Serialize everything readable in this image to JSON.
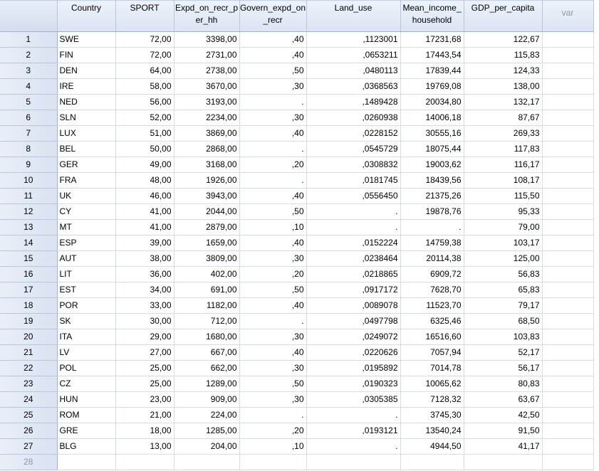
{
  "columns": [
    {
      "key": "Country",
      "label": "Country"
    },
    {
      "key": "SPORT",
      "label": "SPORT"
    },
    {
      "key": "Expd",
      "label": "Expd_on_recr_per_hh"
    },
    {
      "key": "Govern",
      "label": "Govern_expd_on_recr"
    },
    {
      "key": "Land",
      "label": "Land_use"
    },
    {
      "key": "Mean",
      "label": "Mean_income_household"
    },
    {
      "key": "GDP",
      "label": "GDP_per_capita"
    },
    {
      "key": "var",
      "label": "var"
    }
  ],
  "rows": [
    {
      "n": "1",
      "cells": [
        "SWE",
        "72,00",
        "3398,00",
        ",40",
        ",1123001",
        "17231,68",
        "122,67"
      ]
    },
    {
      "n": "2",
      "cells": [
        "FIN",
        "72,00",
        "2731,00",
        ",40",
        ",0653211",
        "17443,54",
        "115,83"
      ]
    },
    {
      "n": "3",
      "cells": [
        "DEN",
        "64,00",
        "2738,00",
        ",50",
        ",0480113",
        "17839,44",
        "124,33"
      ]
    },
    {
      "n": "4",
      "cells": [
        "IRE",
        "58,00",
        "3670,00",
        ",30",
        ",0368563",
        "19769,08",
        "138,00"
      ]
    },
    {
      "n": "5",
      "cells": [
        "NED",
        "56,00",
        "3193,00",
        ".",
        ",1489428",
        "20034,80",
        "132,17"
      ]
    },
    {
      "n": "6",
      "cells": [
        "SLN",
        "52,00",
        "2234,00",
        ",30",
        ",0260938",
        "14006,18",
        "87,67"
      ]
    },
    {
      "n": "7",
      "cells": [
        "LUX",
        "51,00",
        "3869,00",
        ",40",
        ",0228152",
        "30555,16",
        "269,33"
      ]
    },
    {
      "n": "8",
      "cells": [
        "BEL",
        "50,00",
        "2868,00",
        ".",
        ",0545729",
        "18075,44",
        "117,83"
      ]
    },
    {
      "n": "9",
      "cells": [
        "GER",
        "49,00",
        "3168,00",
        ",20",
        ",0308832",
        "19003,62",
        "116,17"
      ]
    },
    {
      "n": "10",
      "cells": [
        "FRA",
        "48,00",
        "1926,00",
        ".",
        ",0181745",
        "18439,56",
        "108,17"
      ]
    },
    {
      "n": "11",
      "cells": [
        "UK",
        "46,00",
        "3943,00",
        ",40",
        ",0556450",
        "21375,26",
        "115,50"
      ]
    },
    {
      "n": "12",
      "cells": [
        "CY",
        "41,00",
        "2044,00",
        ",50",
        ".",
        "19878,76",
        "95,33"
      ]
    },
    {
      "n": "13",
      "cells": [
        "MT",
        "41,00",
        "2879,00",
        ",10",
        ".",
        ".",
        "79,00"
      ]
    },
    {
      "n": "14",
      "cells": [
        "ESP",
        "39,00",
        "1659,00",
        ",40",
        ",0152224",
        "14759,38",
        "103,17"
      ]
    },
    {
      "n": "15",
      "cells": [
        "AUT",
        "38,00",
        "3809,00",
        ",30",
        ",0238464",
        "20114,38",
        "125,00"
      ]
    },
    {
      "n": "16",
      "cells": [
        "LIT",
        "36,00",
        "402,00",
        ",20",
        ",0218865",
        "6909,72",
        "56,83"
      ]
    },
    {
      "n": "17",
      "cells": [
        "EST",
        "34,00",
        "691,00",
        ",50",
        ",0917172",
        "7628,70",
        "65,83"
      ]
    },
    {
      "n": "18",
      "cells": [
        "POR",
        "33,00",
        "1182,00",
        ",40",
        ",0089078",
        "11523,70",
        "79,17"
      ]
    },
    {
      "n": "19",
      "cells": [
        "SK",
        "30,00",
        "712,00",
        ".",
        ",0497798",
        "6325,46",
        "68,50"
      ]
    },
    {
      "n": "20",
      "cells": [
        "ITA",
        "29,00",
        "1680,00",
        ",30",
        ",0249072",
        "16516,60",
        "103,83"
      ]
    },
    {
      "n": "21",
      "cells": [
        "LV",
        "27,00",
        "667,00",
        ",40",
        ",0220626",
        "7057,94",
        "52,17"
      ]
    },
    {
      "n": "22",
      "cells": [
        "POL",
        "25,00",
        "662,00",
        ",30",
        ",0195892",
        "7014,78",
        "56,17"
      ]
    },
    {
      "n": "23",
      "cells": [
        "CZ",
        "25,00",
        "1289,00",
        ",50",
        ",0190323",
        "10065,62",
        "80,83"
      ]
    },
    {
      "n": "24",
      "cells": [
        "HUN",
        "23,00",
        "909,00",
        ",30",
        ",0305385",
        "7128,32",
        "63,67"
      ]
    },
    {
      "n": "25",
      "cells": [
        "ROM",
        "21,00",
        "224,00",
        ".",
        ".",
        "3745,30",
        "42,50"
      ]
    },
    {
      "n": "26",
      "cells": [
        "GRE",
        "18,00",
        "1285,00",
        ",20",
        ",0193121",
        "13540,24",
        "91,50"
      ]
    },
    {
      "n": "27",
      "cells": [
        "BLG",
        "13,00",
        "204,00",
        ",10",
        ".",
        "4944,50",
        "41,17"
      ]
    }
  ],
  "empty_rows": [
    "28"
  ]
}
